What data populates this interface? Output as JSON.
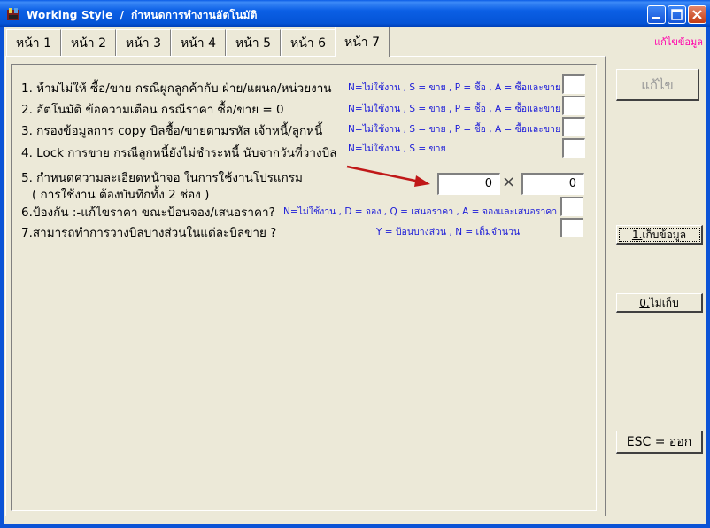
{
  "window": {
    "title_en": "Working Style",
    "title_sep": "/",
    "title_th": "กำหนดการทำงานอัตโนมัติ"
  },
  "tabs": [
    "หน้า 1",
    "หน้า 2",
    "หน้า 3",
    "หน้า 4",
    "หน้า 5",
    "หน้า 6",
    "หน้า 7"
  ],
  "active_tab": 6,
  "edit_mode_label": "แก้ไขข้อมูล",
  "questions": [
    {
      "text": "1. ห้ามไม่ให้ ซื้อ/ขาย กรณีผูกลูกค้ากับ ฝ่าย/แผนก/หน่วยงาน",
      "hint": "N=ไม่ใช้งาน , S = ขาย , P = ซื้อ , A = ซื้อและขาย",
      "value": ""
    },
    {
      "text": "2. อัตโนมัติ ข้อความเตือน กรณีราคา ซื้อ/ขาย = 0",
      "hint": "N=ไม่ใช้งาน , S = ขาย , P = ซื้อ , A = ซื้อและขาย",
      "value": ""
    },
    {
      "text": "3. กรองข้อมูลการ copy บิลซื้อ/ขายตามรหัส เจ้าหนี้/ลูกหนี้",
      "hint": "N=ไม่ใช้งาน , S = ขาย , P = ซื้อ , A = ซื้อและขาย",
      "value": ""
    },
    {
      "text": "4. Lock การขาย กรณีลูกหนี้ยังไม่ชำระหนี้ นับจากวันที่วางบิล",
      "hint": "N=ไม่ใช้งาน , S = ขาย",
      "value": ""
    }
  ],
  "q5": {
    "line1": "5. กำหนดความละเอียดหน้าจอ ในการใช้งานโปรแกรม",
    "line2": "( การใช้งาน ต้องบันทึกทั้ง 2 ช่อง )",
    "width": "0",
    "height": "0",
    "times": "×"
  },
  "q6": {
    "text": "6.ป้องกัน :-แก้ไขราคา ขณะป้อนจอง/เสนอราคา?",
    "hint": "N=ไม่ใช้งาน , D = จอง , Q = เสนอราคา , A = จองและเสนอราคา",
    "value": ""
  },
  "q7": {
    "text": "7.สามารถทำการวางบิลบางส่วนในแต่ละบิลขาย ?",
    "hint": "Y = ป้อนบางส่วน , N = เต็มจำนวน",
    "value": ""
  },
  "buttons": {
    "edit": "แก้ไข",
    "save_key": "1.",
    "save": "เก็บข้อมูล",
    "discard_key": "0.",
    "discard": "ไม่เก็บ",
    "esc": "ESC = ออก"
  },
  "colors": {
    "titlebar": "#0554d6",
    "hint": "#1b1bd8",
    "edit_mode": "#ff00aa",
    "arrow": "#c01818"
  },
  "icons": {
    "app": "app-icon",
    "minimize": "minimize-icon",
    "maximize": "maximize-icon",
    "close": "close-icon",
    "arrow": "red-arrow-icon"
  }
}
